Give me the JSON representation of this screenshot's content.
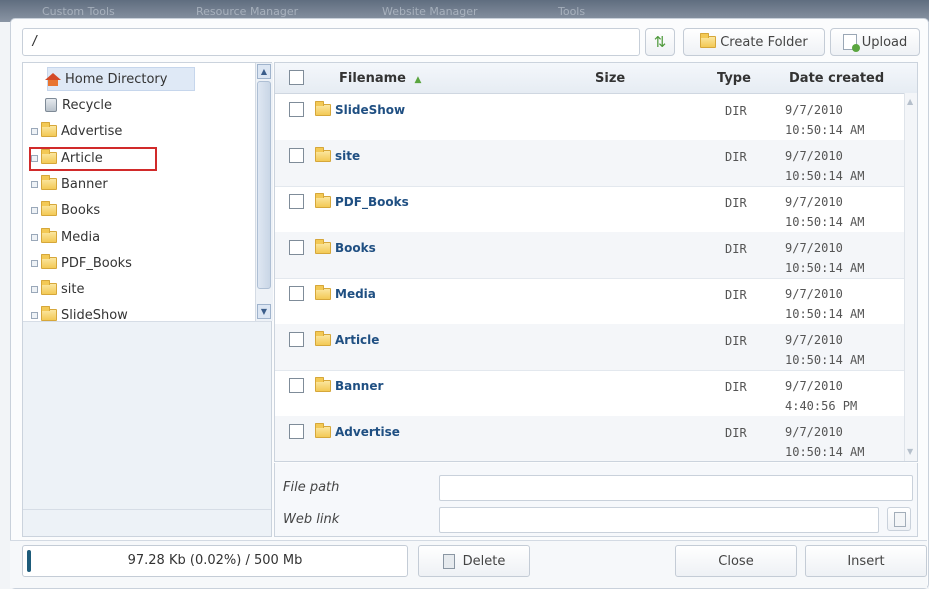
{
  "top_tabs": [
    "Custom Tools",
    "Resource Manager",
    "Website Manager",
    "Tools"
  ],
  "path": "/",
  "toolbar": {
    "refresh_icon": "refresh-icon",
    "create_folder": "Create Folder",
    "upload": "Upload"
  },
  "tree": {
    "items": [
      {
        "label": "Home Directory",
        "icon": "home-icon"
      },
      {
        "label": "Recycle",
        "icon": "recycle-icon"
      },
      {
        "label": "Advertise",
        "icon": "folder-icon"
      },
      {
        "label": "Article",
        "icon": "folder-icon"
      },
      {
        "label": "Banner",
        "icon": "folder-icon"
      },
      {
        "label": "Books",
        "icon": "folder-icon"
      },
      {
        "label": "Media",
        "icon": "folder-icon"
      },
      {
        "label": "PDF_Books",
        "icon": "folder-icon"
      },
      {
        "label": "site",
        "icon": "folder-icon"
      },
      {
        "label": "SlideShow",
        "icon": "folder-icon"
      }
    ]
  },
  "table": {
    "headers": {
      "filename": "Filename",
      "size": "Size",
      "type": "Type",
      "date": "Date created"
    },
    "rows": [
      {
        "name": "SlideShow",
        "type": "DIR",
        "date1": "9/7/2010",
        "date2": "10:50:14 AM"
      },
      {
        "name": "site",
        "type": "DIR",
        "date1": "9/7/2010",
        "date2": "10:50:14 AM"
      },
      {
        "name": "PDF_Books",
        "type": "DIR",
        "date1": "9/7/2010",
        "date2": "10:50:14 AM"
      },
      {
        "name": "Books",
        "type": "DIR",
        "date1": "9/7/2010",
        "date2": "10:50:14 AM"
      },
      {
        "name": "Media",
        "type": "DIR",
        "date1": "9/7/2010",
        "date2": "10:50:14 AM"
      },
      {
        "name": "Article",
        "type": "DIR",
        "date1": "9/7/2010",
        "date2": "10:50:14 AM"
      },
      {
        "name": "Banner",
        "type": "DIR",
        "date1": "9/7/2010",
        "date2": "4:40:56 PM"
      },
      {
        "name": "Advertise",
        "type": "DIR",
        "date1": "9/7/2010",
        "date2": "10:50:14 AM"
      }
    ]
  },
  "fields": {
    "file_path": "File path",
    "web_link": "Web link"
  },
  "footer": {
    "quota": "97.28 Kb (0.02%) / 500 Mb",
    "delete": "Delete",
    "close": "Close",
    "insert": "Insert"
  },
  "colors": {
    "accent": "#1f4f82",
    "highlight": "#d12a2a"
  }
}
